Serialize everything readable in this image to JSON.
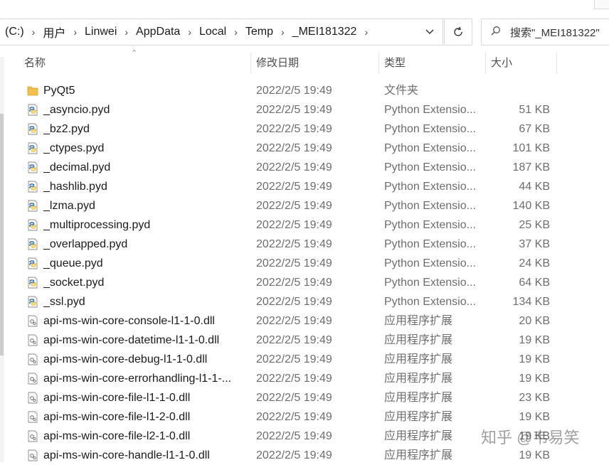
{
  "addressbar": {
    "crumbs": [
      "(C:)",
      "用户",
      "Linwei",
      "AppData",
      "Local",
      "Temp",
      "_MEI181322"
    ],
    "separator": "›",
    "dropdown_icon": "chevron-down-icon"
  },
  "refresh_icon": "refresh-icon",
  "search": {
    "placeholder": "搜索\"_MEI181322\""
  },
  "columns": {
    "name": "名称",
    "date": "修改日期",
    "type": "类型",
    "size": "大小"
  },
  "files": [
    {
      "name": "PyQt5",
      "date": "2022/2/5 19:49",
      "type": "文件夹",
      "size": "",
      "icon": "folder"
    },
    {
      "name": "_asyncio.pyd",
      "date": "2022/2/5 19:49",
      "type": "Python Extensio...",
      "size": "51 KB",
      "icon": "python"
    },
    {
      "name": "_bz2.pyd",
      "date": "2022/2/5 19:49",
      "type": "Python Extensio...",
      "size": "67 KB",
      "icon": "python"
    },
    {
      "name": "_ctypes.pyd",
      "date": "2022/2/5 19:49",
      "type": "Python Extensio...",
      "size": "101 KB",
      "icon": "python"
    },
    {
      "name": "_decimal.pyd",
      "date": "2022/2/5 19:49",
      "type": "Python Extensio...",
      "size": "187 KB",
      "icon": "python"
    },
    {
      "name": "_hashlib.pyd",
      "date": "2022/2/5 19:49",
      "type": "Python Extensio...",
      "size": "44 KB",
      "icon": "python"
    },
    {
      "name": "_lzma.pyd",
      "date": "2022/2/5 19:49",
      "type": "Python Extensio...",
      "size": "140 KB",
      "icon": "python"
    },
    {
      "name": "_multiprocessing.pyd",
      "date": "2022/2/5 19:49",
      "type": "Python Extensio...",
      "size": "25 KB",
      "icon": "python"
    },
    {
      "name": "_overlapped.pyd",
      "date": "2022/2/5 19:49",
      "type": "Python Extensio...",
      "size": "37 KB",
      "icon": "python"
    },
    {
      "name": "_queue.pyd",
      "date": "2022/2/5 19:49",
      "type": "Python Extensio...",
      "size": "24 KB",
      "icon": "python"
    },
    {
      "name": "_socket.pyd",
      "date": "2022/2/5 19:49",
      "type": "Python Extensio...",
      "size": "64 KB",
      "icon": "python"
    },
    {
      "name": "_ssl.pyd",
      "date": "2022/2/5 19:49",
      "type": "Python Extensio...",
      "size": "134 KB",
      "icon": "python"
    },
    {
      "name": "api-ms-win-core-console-l1-1-0.dll",
      "date": "2022/2/5 19:49",
      "type": "应用程序扩展",
      "size": "20 KB",
      "icon": "dll"
    },
    {
      "name": "api-ms-win-core-datetime-l1-1-0.dll",
      "date": "2022/2/5 19:49",
      "type": "应用程序扩展",
      "size": "19 KB",
      "icon": "dll"
    },
    {
      "name": "api-ms-win-core-debug-l1-1-0.dll",
      "date": "2022/2/5 19:49",
      "type": "应用程序扩展",
      "size": "19 KB",
      "icon": "dll"
    },
    {
      "name": "api-ms-win-core-errorhandling-l1-1-...",
      "date": "2022/2/5 19:49",
      "type": "应用程序扩展",
      "size": "19 KB",
      "icon": "dll"
    },
    {
      "name": "api-ms-win-core-file-l1-1-0.dll",
      "date": "2022/2/5 19:49",
      "type": "应用程序扩展",
      "size": "23 KB",
      "icon": "dll"
    },
    {
      "name": "api-ms-win-core-file-l1-2-0.dll",
      "date": "2022/2/5 19:49",
      "type": "应用程序扩展",
      "size": "19 KB",
      "icon": "dll"
    },
    {
      "name": "api-ms-win-core-file-l2-1-0.dll",
      "date": "2022/2/5 19:49",
      "type": "应用程序扩展",
      "size": "19 KB",
      "icon": "dll"
    },
    {
      "name": "api-ms-win-core-handle-l1-1-0.dll",
      "date": "2022/2/5 19:49",
      "type": "应用程序扩展",
      "size": "19 KB",
      "icon": "dll"
    }
  ],
  "watermark": "知乎 @韦易笑",
  "colors": {
    "folder": "#f3c14b",
    "python_blue": "#3a75b0",
    "python_yellow": "#f2c53d"
  }
}
